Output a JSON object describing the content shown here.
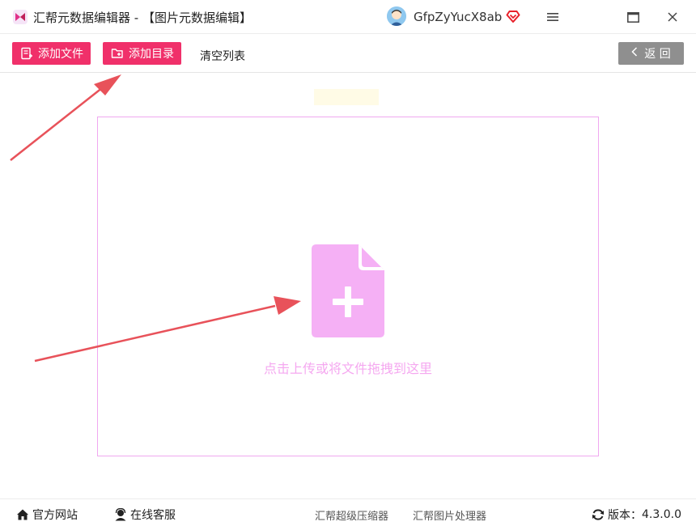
{
  "titlebar": {
    "app_title": "汇帮元数据编辑器 - 【图片元数据编辑】",
    "username": "GfpZyYucX8ab",
    "icons": [
      "app-logo",
      "avatar",
      "vip-heart-icon",
      "menu-icon",
      "maximize-icon",
      "close-icon"
    ]
  },
  "toolbar": {
    "add_file_label": "添加文件",
    "add_dir_label": "添加目录",
    "clear_label": "清空列表",
    "back_label": "返 回"
  },
  "main": {
    "drop_text": "点击上传或将文件拖拽到这里"
  },
  "footer": {
    "website_label": "官方网站",
    "support_label": "在线客服",
    "compressor_label": "汇帮超级压缩器",
    "image_tool_label": "汇帮图片处理器",
    "version_label": "版本：",
    "version_value": "4.3.0.0"
  },
  "colors": {
    "accent": "#f0306a",
    "drop_border": "#f0a8f0",
    "drop_icon": "#f5b0f5",
    "arrow": "#e8525a",
    "back_button": "#8f8f8f"
  }
}
